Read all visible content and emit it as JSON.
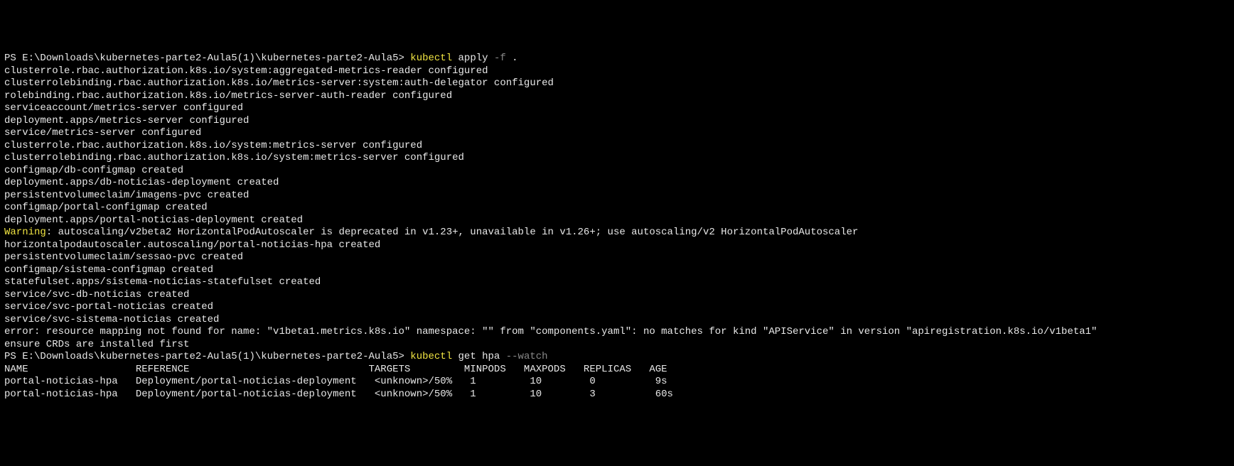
{
  "prompt1": {
    "ps": "PS E:\\Downloads\\kubernetes-parte2-Aula5(1)\\kubernetes-parte2-Aula5> ",
    "cmd": "kubectl ",
    "subcmd": "apply ",
    "flag": "-f ",
    "arg": "."
  },
  "output1": [
    "clusterrole.rbac.authorization.k8s.io/system:aggregated-metrics-reader configured",
    "clusterrolebinding.rbac.authorization.k8s.io/metrics-server:system:auth-delegator configured",
    "rolebinding.rbac.authorization.k8s.io/metrics-server-auth-reader configured",
    "serviceaccount/metrics-server configured",
    "deployment.apps/metrics-server configured",
    "service/metrics-server configured",
    "clusterrole.rbac.authorization.k8s.io/system:metrics-server configured",
    "clusterrolebinding.rbac.authorization.k8s.io/system:metrics-server configured",
    "configmap/db-configmap created",
    "deployment.apps/db-noticias-deployment created",
    "persistentvolumeclaim/imagens-pvc created",
    "configmap/portal-configmap created",
    "deployment.apps/portal-noticias-deployment created"
  ],
  "warning": {
    "label": "Warning",
    "text": ": autoscaling/v2beta2 HorizontalPodAutoscaler is deprecated in v1.23+, unavailable in v1.26+; use autoscaling/v2 HorizontalPodAutoscaler"
  },
  "output2": [
    "horizontalpodautoscaler.autoscaling/portal-noticias-hpa created",
    "persistentvolumeclaim/sessao-pvc created",
    "configmap/sistema-configmap created",
    "statefulset.apps/sistema-noticias-statefulset created",
    "service/svc-db-noticias created",
    "service/svc-portal-noticias created",
    "service/svc-sistema-noticias created",
    "error: resource mapping not found for name: \"v1beta1.metrics.k8s.io\" namespace: \"\" from \"components.yaml\": no matches for kind \"APIService\" in version \"apiregistration.k8s.io/v1beta1\"",
    "ensure CRDs are installed first"
  ],
  "prompt2": {
    "ps": "PS E:\\Downloads\\kubernetes-parte2-Aula5(1)\\kubernetes-parte2-Aula5> ",
    "cmd": "kubectl ",
    "subcmd": "get hpa ",
    "flag": "--watch"
  },
  "table": {
    "header": "NAME                  REFERENCE                              TARGETS         MINPODS   MAXPODS   REPLICAS   AGE",
    "rows": [
      "portal-noticias-hpa   Deployment/portal-noticias-deployment   <unknown>/50%   1         10        0          9s",
      "portal-noticias-hpa   Deployment/portal-noticias-deployment   <unknown>/50%   1         10        3          60s"
    ]
  }
}
